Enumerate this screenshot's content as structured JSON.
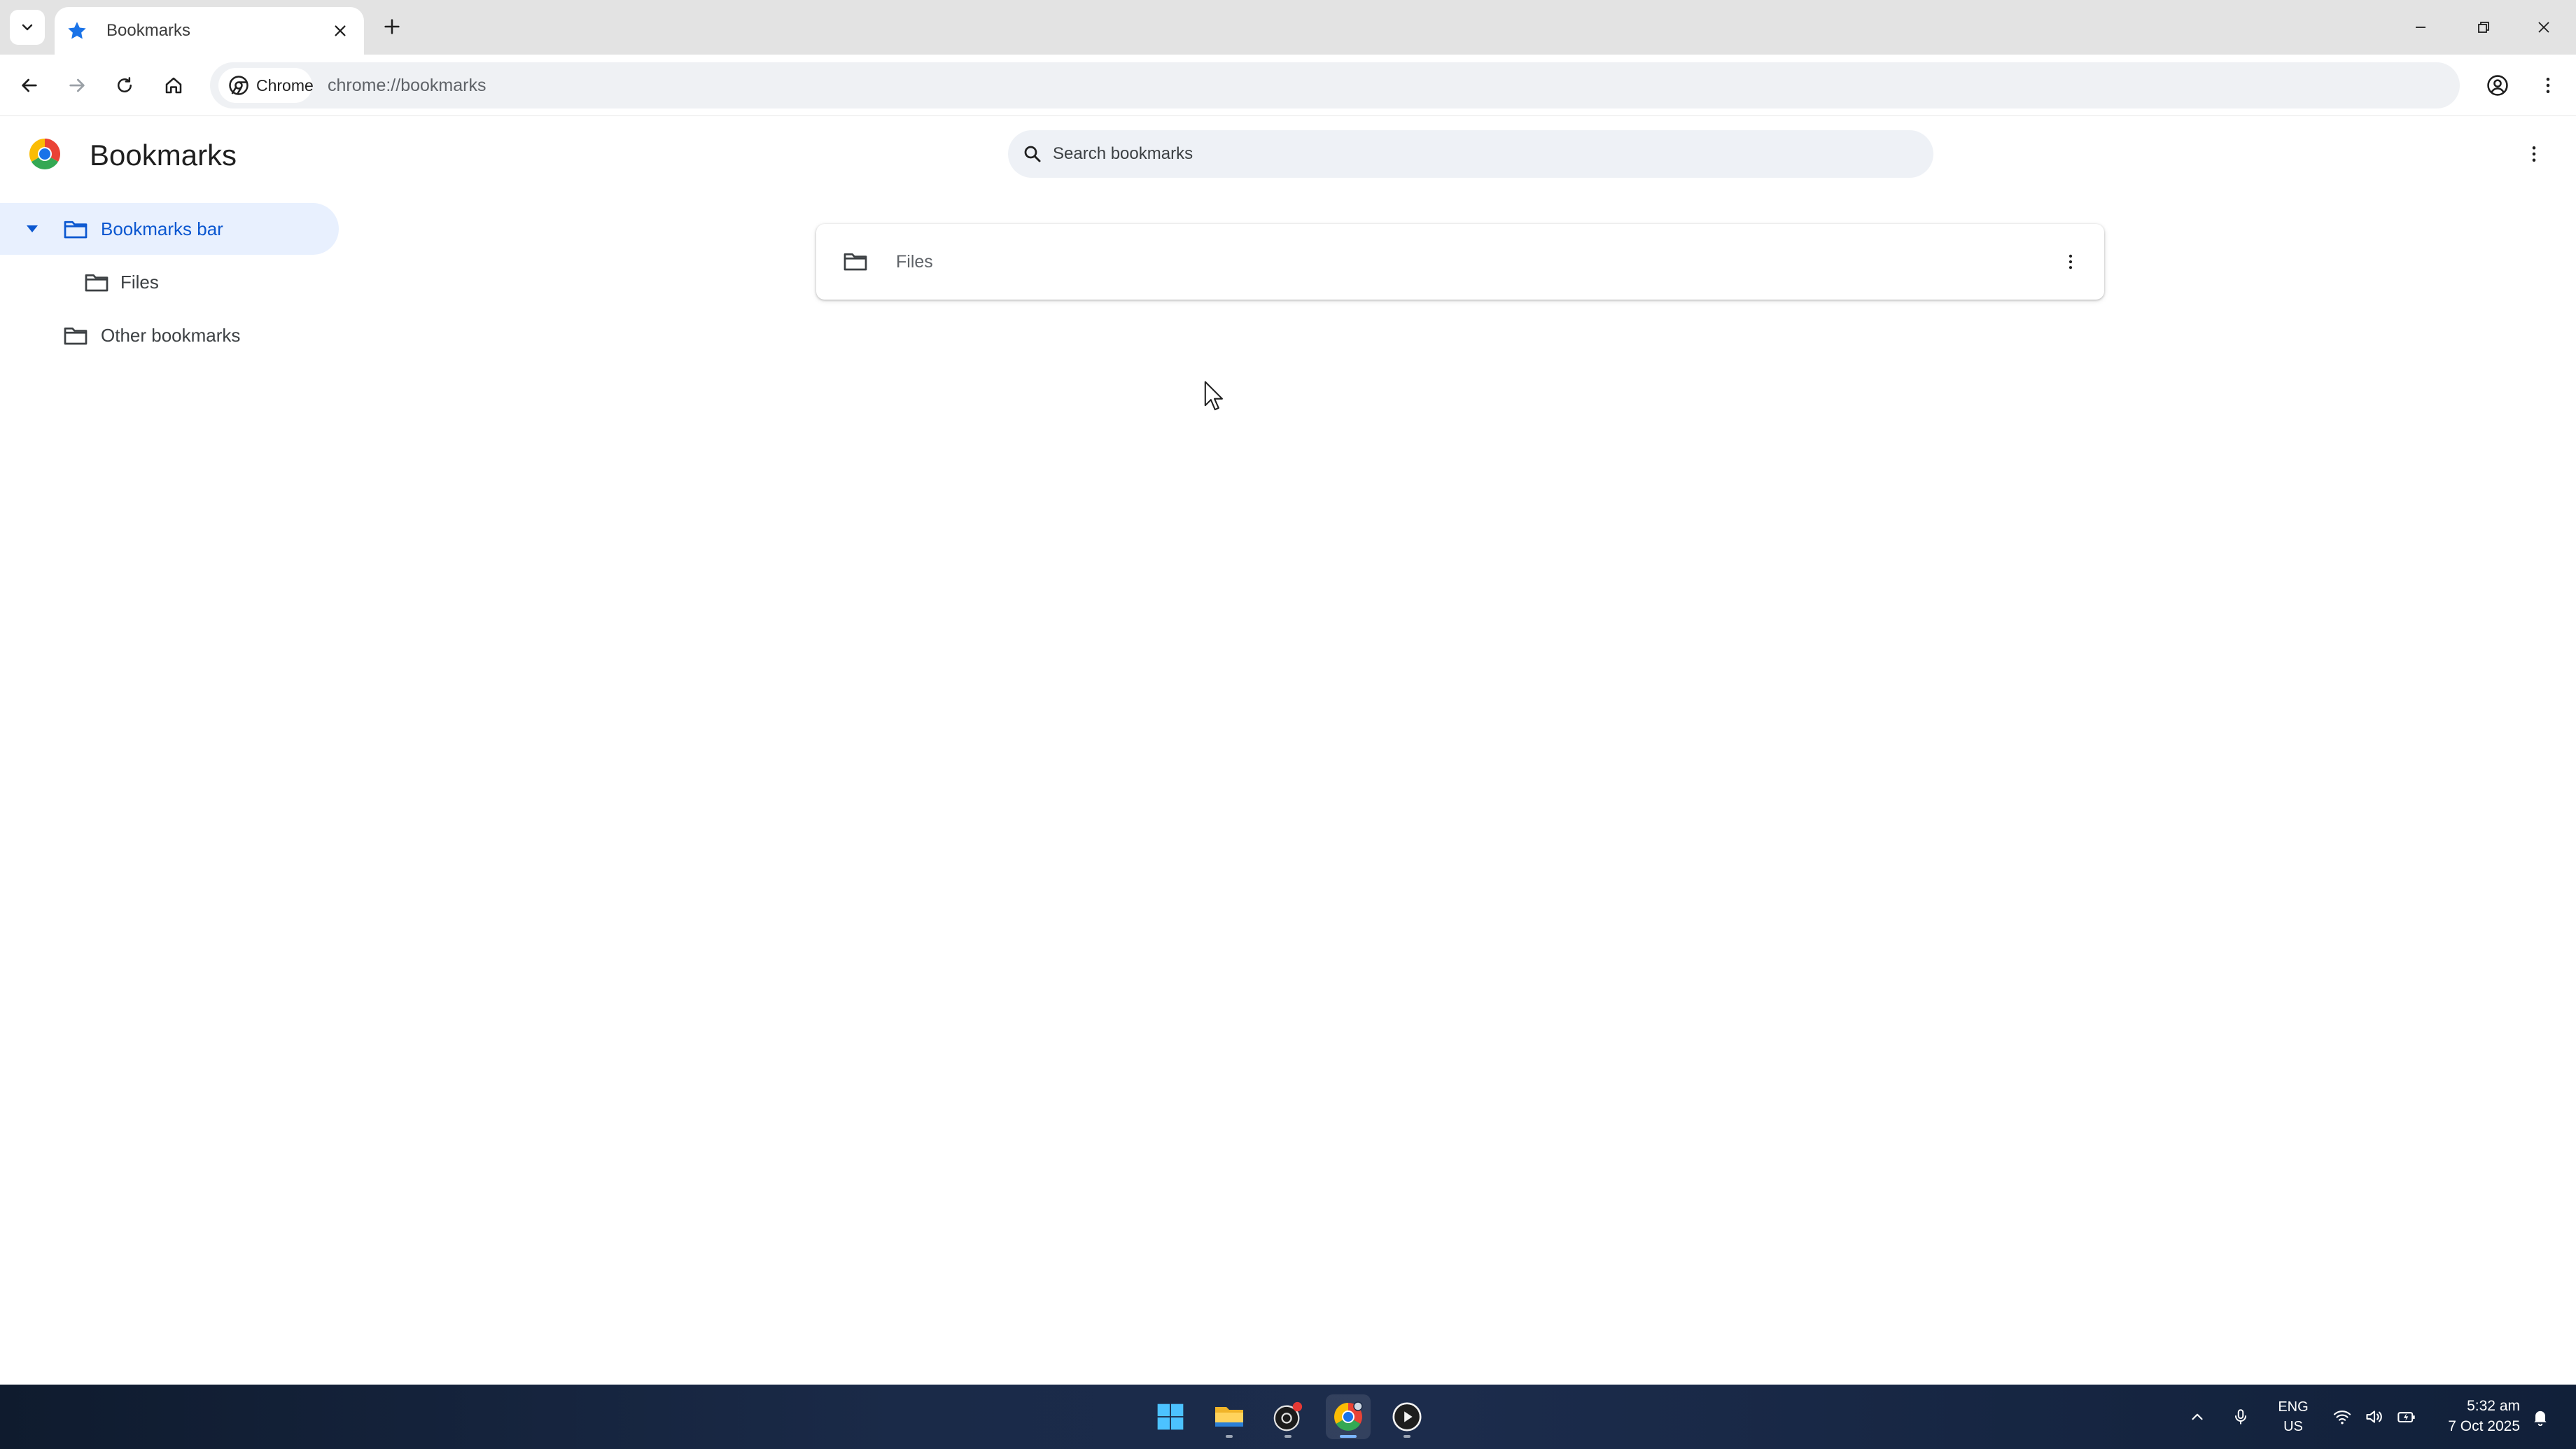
{
  "tab": {
    "title": "Bookmarks"
  },
  "toolbar": {
    "chip_label": "Chrome",
    "url": "chrome://bookmarks"
  },
  "page": {
    "title": "Bookmarks",
    "search_placeholder": "Search bookmarks"
  },
  "sidebar": {
    "items": [
      {
        "label": "Bookmarks bar"
      },
      {
        "label": "Files"
      },
      {
        "label": "Other bookmarks"
      }
    ]
  },
  "content": {
    "items": [
      {
        "label": "Files"
      }
    ]
  },
  "taskbar": {
    "language": "ENG",
    "region": "US",
    "time": "5:32 am",
    "date": "7 Oct 2025"
  },
  "colors": {
    "accent": "#0b57d0",
    "selected_bg": "#e8f0fe",
    "tabstrip_bg": "#e3e3e3"
  }
}
